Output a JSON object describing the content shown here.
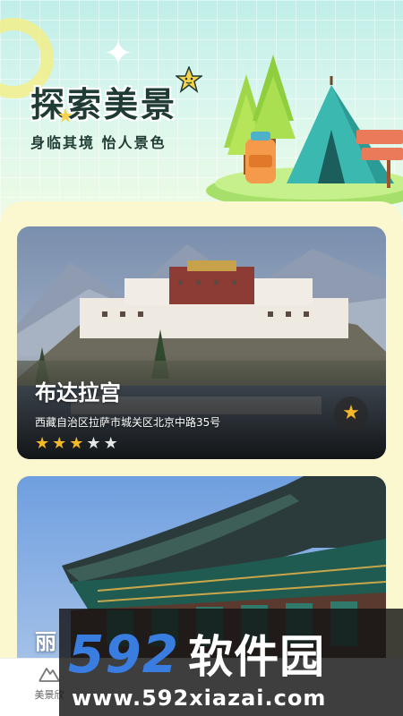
{
  "header": {
    "title": "探索美景",
    "subtitle": "身临其境  怡人景色"
  },
  "spots": [
    {
      "name": "布达拉宫",
      "address": "西藏自治区拉萨市城关区北京中路35号",
      "rating": 3,
      "rating_max": 5,
      "favorite_icon": "star-icon"
    },
    {
      "name": "丽"
    }
  ],
  "tabbar": {
    "items": [
      {
        "label": "美景欣",
        "icon": "mountain-icon"
      }
    ]
  },
  "watermark": {
    "logo_number": "592",
    "logo_text": "软件园",
    "url": "www.592xiazai.com"
  },
  "colors": {
    "header_bg": "#bfeee8",
    "panel_bg": "#fbf7cf",
    "star_active": "#f5b928",
    "watermark_blue": "#3a7de0"
  }
}
